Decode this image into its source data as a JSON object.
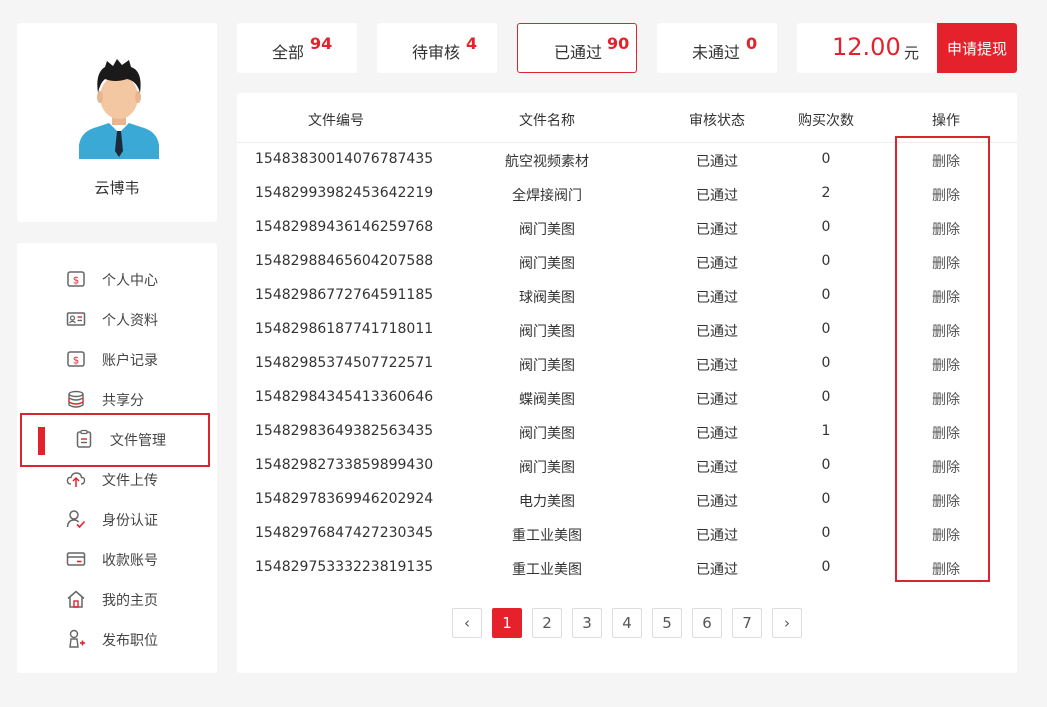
{
  "profile": {
    "name": "云博韦"
  },
  "menu": [
    {
      "label": "个人中心",
      "icon": "money-icon"
    },
    {
      "label": "个人资料",
      "icon": "id-card-icon"
    },
    {
      "label": "账户记录",
      "icon": "money-icon"
    },
    {
      "label": "共享分",
      "icon": "coins-icon"
    },
    {
      "label": "文件管理",
      "icon": "clipboard-icon",
      "active": true
    },
    {
      "label": "文件上传",
      "icon": "cloud-upload-icon"
    },
    {
      "label": "身份认证",
      "icon": "user-check-icon"
    },
    {
      "label": "收款账号",
      "icon": "bank-card-icon"
    },
    {
      "label": "我的主页",
      "icon": "home-icon"
    },
    {
      "label": "发布职位",
      "icon": "post-job-icon"
    }
  ],
  "stats": {
    "all": {
      "label": "全部",
      "count": "94"
    },
    "pending": {
      "label": "待审核",
      "count": "4"
    },
    "approved": {
      "label": "已通过",
      "count": "90"
    },
    "rejected": {
      "label": "未通过",
      "count": "0"
    }
  },
  "balance": {
    "amount": "12.00",
    "unit": "元",
    "withdraw_label": "申请提现"
  },
  "table": {
    "headers": [
      "文件编号",
      "文件名称",
      "审核状态",
      "购买次数",
      "操作"
    ],
    "rows": [
      {
        "id": "1548383001407678743​5",
        "name": "航空视频素材",
        "status": "已通过",
        "count": "0",
        "action": "删除"
      },
      {
        "id": "15482993982453642219",
        "name": "全焊接阀门",
        "status": "已通过",
        "count": "2",
        "action": "删除"
      },
      {
        "id": "15482989436146259768",
        "name": "阀门美图",
        "status": "已通过",
        "count": "0",
        "action": "删除"
      },
      {
        "id": "15482988465604207588",
        "name": "阀门美图",
        "status": "已通过",
        "count": "0",
        "action": "删除"
      },
      {
        "id": "15482986772764591185",
        "name": "球阀美图",
        "status": "已通过",
        "count": "0",
        "action": "删除"
      },
      {
        "id": "15482986187741718011",
        "name": "阀门美图",
        "status": "已通过",
        "count": "0",
        "action": "删除"
      },
      {
        "id": "15482985374507722571",
        "name": "阀门美图",
        "status": "已通过",
        "count": "0",
        "action": "删除"
      },
      {
        "id": "15482984345413360646",
        "name": "蝶阀美图",
        "status": "已通过",
        "count": "0",
        "action": "删除"
      },
      {
        "id": "15482983649382563435",
        "name": "阀门美图",
        "status": "已通过",
        "count": "1",
        "action": "删除"
      },
      {
        "id": "15482982733859899430",
        "name": "阀门美图",
        "status": "已通过",
        "count": "0",
        "action": "删除"
      },
      {
        "id": "15482978369946202924",
        "name": "电力美图",
        "status": "已通过",
        "count": "0",
        "action": "删除"
      },
      {
        "id": "15482976847427230345",
        "name": "重工业美图",
        "status": "已通过",
        "count": "0",
        "action": "删除"
      },
      {
        "id": "15482975333223819135",
        "name": "重工业美图",
        "status": "已通过",
        "count": "0",
        "action": "删除"
      }
    ]
  },
  "pagination": {
    "prev": "‹",
    "next": "›",
    "pages": [
      "1",
      "2",
      "3",
      "4",
      "5",
      "6",
      "7"
    ],
    "current": "1"
  },
  "colors": {
    "accent": "#e5222b",
    "highlight_border": "#d9252d"
  }
}
